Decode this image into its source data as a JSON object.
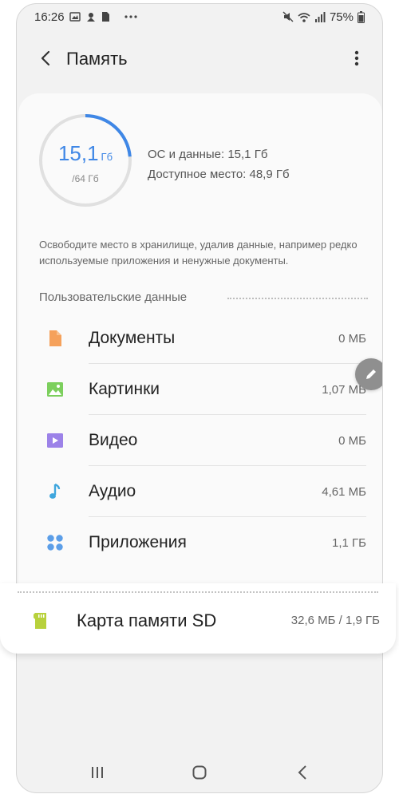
{
  "status_bar": {
    "time": "16:26",
    "battery_percent": "75%",
    "icons": [
      "gallery-icon",
      "sim-icon",
      "notification-icon",
      "more-dots-icon",
      "mute-icon",
      "wifi-icon",
      "signal-icon",
      "battery-icon"
    ]
  },
  "header": {
    "title": "Память"
  },
  "storage": {
    "used_value": "15,1",
    "used_unit": "Гб",
    "total": "/64 Гб",
    "used_fraction": 0.236,
    "os_data": "ОС и данные: 15,1 Гб",
    "free_space": "Доступное место: 48,9 Гб",
    "accent_color": "#3f87e6"
  },
  "hint": "Освободите место в хранилище, удалив данные, например редко используемые приложения и ненужные документы.",
  "user_data": {
    "header": "Пользовательские данные",
    "items": [
      {
        "label": "Документы",
        "size": "0 МБ",
        "icon": "document-icon",
        "color": "#f5a15b"
      },
      {
        "label": "Картинки",
        "size": "1,07 МБ",
        "icon": "image-icon",
        "color": "#7ccf5d"
      },
      {
        "label": "Видео",
        "size": "0 МБ",
        "icon": "video-icon",
        "color": "#9c82e8"
      },
      {
        "label": "Аудио",
        "size": "4,61 МБ",
        "icon": "audio-icon",
        "color": "#3fa6dd"
      },
      {
        "label": "Приложения",
        "size": "1,1 ГБ",
        "icon": "apps-icon",
        "color": "#5b9ee8"
      }
    ]
  },
  "sd_card": {
    "label": "Карта памяти SD",
    "size": "32,6 МБ / 1,9 ГБ",
    "color": "#b8d13c"
  }
}
